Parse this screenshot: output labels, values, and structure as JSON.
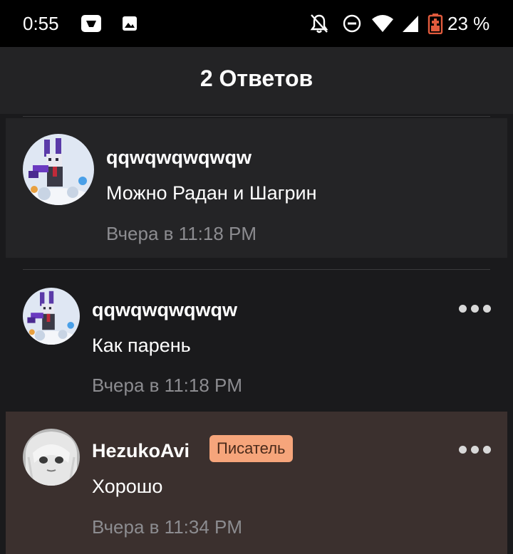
{
  "status_bar": {
    "time": "0:55",
    "battery_percent": "23 %",
    "icons": [
      "video-app-icon",
      "image-notification-icon",
      "bell-off-icon",
      "do-not-disturb-icon",
      "wifi-icon",
      "signal-icon",
      "battery-low-icon"
    ]
  },
  "header": {
    "title": "2 Ответов"
  },
  "comments": [
    {
      "username": "qqwqwqwqwqw",
      "text": "Можно Радан и Шагрин",
      "time": "Вчера в 11:18 PM",
      "avatar": "pixel-art-character-avatar"
    },
    {
      "username": "qqwqwqwqwqw",
      "text": "Как парень",
      "time": "Вчера в 11:18 PM",
      "avatar": "pixel-art-character-avatar",
      "menu_icon": "more-options-icon"
    },
    {
      "username": "HezukoAvi",
      "badge": "Писатель",
      "text": "Хорошо",
      "time": "Вчера в 11:34 PM",
      "avatar": "anime-girl-avatar",
      "menu_icon": "more-options-icon"
    }
  ],
  "colors": {
    "background": "#1a1a1c",
    "header": "#232325",
    "highlight": "#3b302e",
    "badge": "#f6a57b",
    "meta_text": "#8c8c90"
  }
}
